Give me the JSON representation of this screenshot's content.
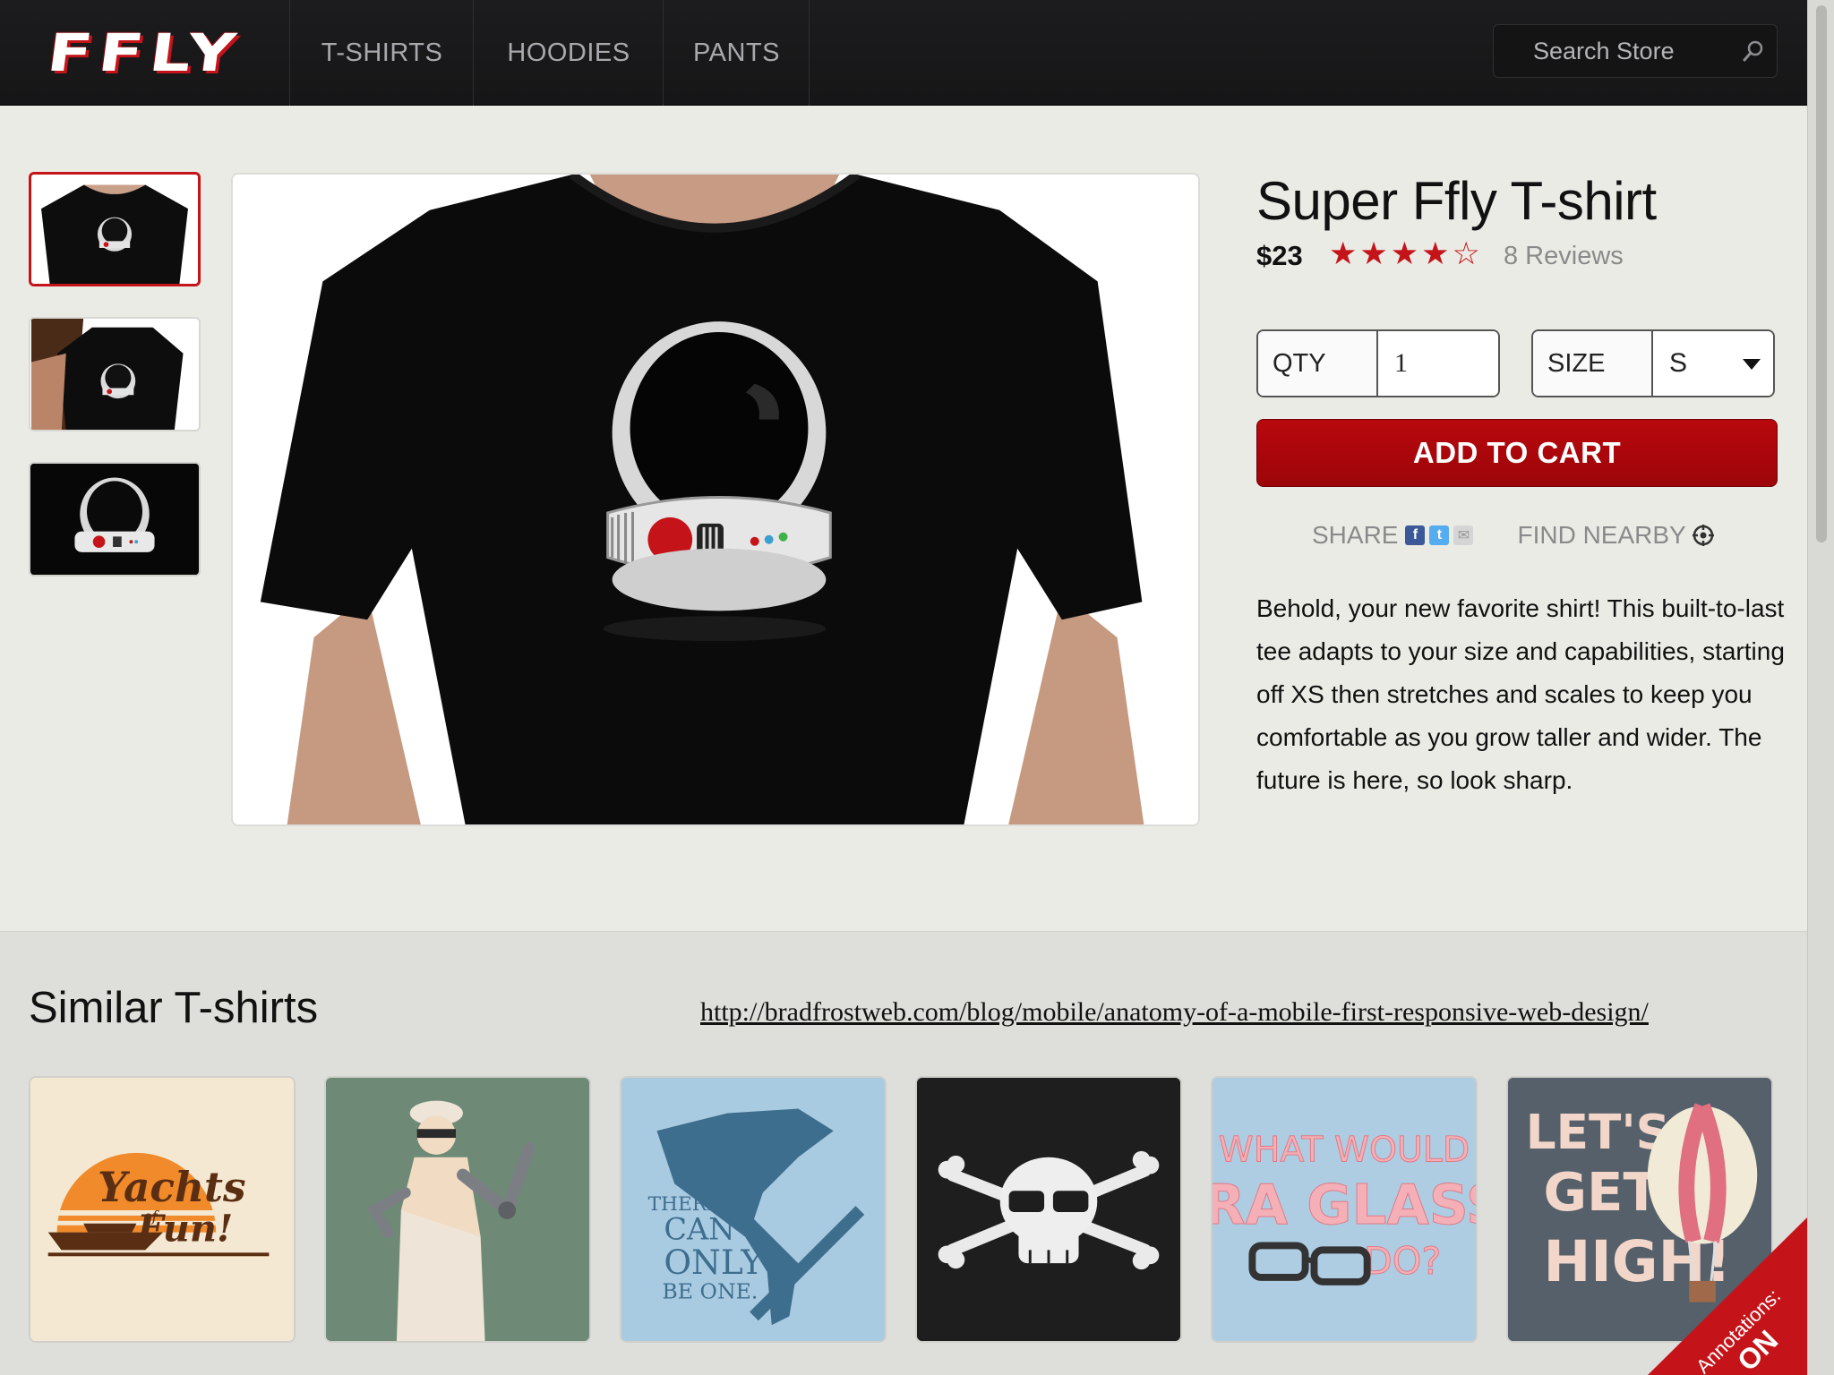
{
  "header": {
    "logo": "FFLY",
    "nav": [
      "T-SHIRTS",
      "HOODIES",
      "PANTS"
    ],
    "search_placeholder": "Search Store"
  },
  "product": {
    "title": "Super Ffly T-shirt",
    "price": "$23",
    "rating": 4,
    "rating_max": 5,
    "stars": "★★★★☆",
    "reviews": "8 Reviews",
    "qty_label": "QTY",
    "qty_value": "1",
    "size_label": "SIZE",
    "size_value": "S",
    "add_to_cart": "ADD TO CART",
    "share_label": "SHARE",
    "find_nearby": "FIND NEARBY",
    "description": "Behold, your new favorite shirt! This built-to-last tee adapts to your size and capabilities, starting off XS then stretches and scales to keep you comfortable as you grow taller and wider. The future is here, so look sharp."
  },
  "similar": {
    "title": "Similar T-shirts",
    "link": "http://bradfrostweb.com/blog/mobile/anatomy-of-a-mobile-first-responsive-web-design/",
    "tiles": [
      {
        "text": "Yachts of Fun!"
      },
      {
        "text": ""
      },
      {
        "text": "THERE CAN ONLY BE ONE."
      },
      {
        "text": ""
      },
      {
        "text": "WHAT WOULD IRA GLASS DO?"
      },
      {
        "text": "LET'S GET HIGH!"
      }
    ]
  },
  "annotations": {
    "label": "Annotations:",
    "state": "ON"
  },
  "colors": {
    "accent": "#c4141a",
    "header_bg": "#1c1c1e",
    "page_bg": "#ebebe6"
  }
}
